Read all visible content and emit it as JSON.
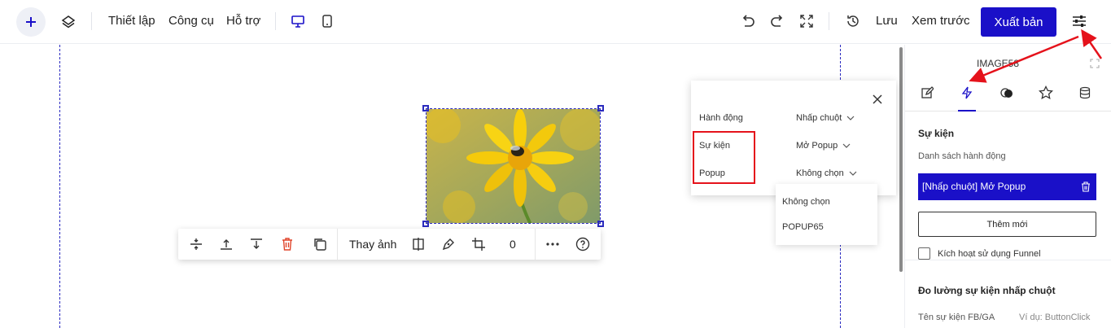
{
  "topbar": {
    "menu": [
      "Thiết lập",
      "Công cụ",
      "Hỗ trợ"
    ],
    "save_label": "Lưu",
    "preview_label": "Xem trước",
    "publish_label": "Xuất bản",
    "icons": [
      "plus-icon",
      "layers-icon",
      "desktop-icon",
      "mobile-icon",
      "undo-icon",
      "redo-icon",
      "fullscreen-icon",
      "history-icon",
      "settings-sliders-icon"
    ]
  },
  "toolbar": {
    "change_image_label": "Thay ảnh",
    "rotation_value": "0",
    "icons": [
      "align-middle-icon",
      "align-top-icon",
      "align-bottom-icon",
      "delete-icon",
      "duplicate-icon",
      "flip-icon",
      "pen-icon",
      "crop-icon",
      "more-icon",
      "help-icon"
    ]
  },
  "popover": {
    "rows": [
      {
        "label": "Hành động",
        "value": "Nhấp chuột"
      },
      {
        "label": "Sự kiện",
        "value": "Mở Popup"
      },
      {
        "label": "Popup",
        "value": "Không chọn"
      }
    ],
    "dropdown_options": [
      "Không chọn",
      "POPUP65"
    ]
  },
  "panel": {
    "element_name": "IMAGE58",
    "tabs": [
      "edit-icon",
      "lightning-icon",
      "blend-icon",
      "star-icon",
      "database-icon"
    ],
    "active_tab": 1,
    "section_title": "Sự kiện",
    "list_label": "Danh sách hành động",
    "action_item": "[Nhấp chuột] Mở Popup",
    "add_label": "Thêm mới",
    "funnel_label": "Kích hoạt sử dụng Funnel",
    "tracking_title": "Đo lường sự kiện nhấp chuột",
    "event_name_label": "Tên sự kiện FB/GA",
    "event_name_placeholder": "Ví dụ: ButtonClick"
  },
  "colors": {
    "accent": "#1a10c8",
    "highlight": "#e5121b",
    "flower": "#f5c800"
  }
}
